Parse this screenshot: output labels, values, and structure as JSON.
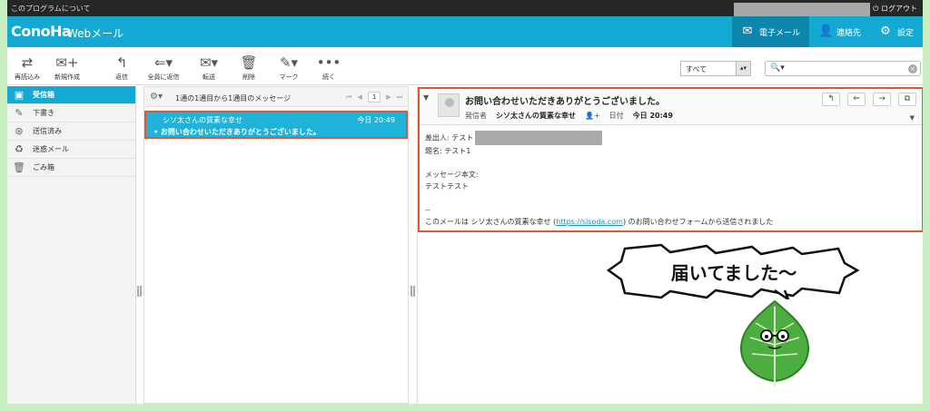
{
  "topbar": {
    "left_link": "このプログラムについて",
    "logout": "ログアウト"
  },
  "header": {
    "logo": "ConoHa",
    "app_name": "Webメール",
    "nav": [
      {
        "label": "電子メール",
        "icon": "envelope-icon"
      },
      {
        "label": "連絡先",
        "icon": "person-icon"
      },
      {
        "label": "設定",
        "icon": "gear-icon"
      }
    ]
  },
  "toolbar": {
    "buttons": [
      {
        "label": "再読込み",
        "icon": "refresh-icon"
      },
      {
        "label": "新規作成",
        "icon": "compose-icon"
      },
      {
        "label": "返信",
        "icon": "reply-icon"
      },
      {
        "label": "全員に返信",
        "icon": "reply-all-icon"
      },
      {
        "label": "転送",
        "icon": "forward-icon"
      },
      {
        "label": "削除",
        "icon": "trash-icon"
      },
      {
        "label": "マーク",
        "icon": "mark-icon"
      },
      {
        "label": "続く",
        "icon": "more-icon"
      }
    ],
    "filter_value": "すべて",
    "search_placeholder": ""
  },
  "sidebar": {
    "folders": [
      {
        "label": "受信箱",
        "icon": "inbox-icon",
        "active": true
      },
      {
        "label": "下書き",
        "icon": "pencil-icon"
      },
      {
        "label": "送信済み",
        "icon": "sent-icon"
      },
      {
        "label": "迷惑メール",
        "icon": "spam-icon"
      },
      {
        "label": "ごみ箱",
        "icon": "trash-icon"
      }
    ]
  },
  "message_list": {
    "count_text": "1通の1通目から1通目のメッセージ",
    "page": "1",
    "items": [
      {
        "from": "シソ太さんの質素な幸せ",
        "time": "今日 20:49",
        "subject": "お問い合わせいただきありがとうございました。"
      }
    ]
  },
  "preview": {
    "subject": "お問い合わせいただきありがとうございました。",
    "from_label": "発信者",
    "from": "シソ太さんの質素な幸せ",
    "date_label": "日付",
    "date": "今日 20:49",
    "body": {
      "sender_line": "差出人: テスト",
      "title_line": "題名: テスト1",
      "body_label": "メッセージ本文:",
      "body_text": "テストテスト",
      "separator": "--",
      "footer_pre": "このメールは シソ太さんの質素な幸せ (",
      "footer_link": "https://sisoda.com",
      "footer_post": ") のお問い合わせフォームから送信されました"
    }
  },
  "annotation": {
    "speech": "届いてました〜"
  },
  "colors": {
    "accent": "#14a9d3",
    "highlight_border": "#e4572e",
    "frame_bg": "#c8efc0"
  }
}
